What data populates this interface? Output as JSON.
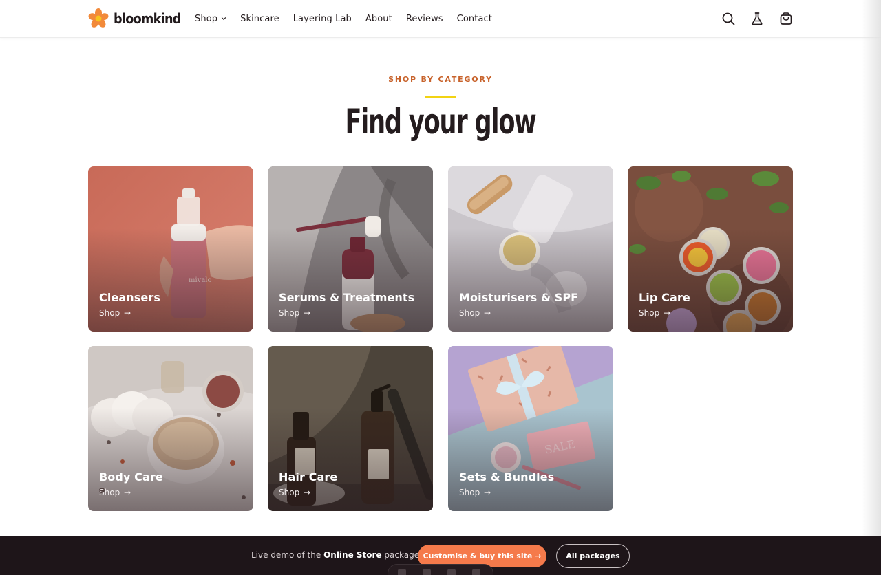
{
  "brand": {
    "name": "bloomkind",
    "logo_icon": "flower-icon",
    "colors": {
      "petal": "#f28a3a",
      "center": "#f7c41f",
      "text": "#211a1c"
    }
  },
  "nav": {
    "items": [
      {
        "label": "Shop",
        "has_caret": true
      },
      {
        "label": "Skincare"
      },
      {
        "label": "Layering Lab"
      },
      {
        "label": "About"
      },
      {
        "label": "Reviews"
      },
      {
        "label": "Contact"
      }
    ],
    "icons": [
      "search-icon",
      "flask-icon",
      "cart-icon"
    ]
  },
  "section": {
    "eyebrow": "SHOP BY CATEGORY",
    "title": "Find your glow",
    "accent": "#c8632c",
    "rule_color": "#f2d313"
  },
  "categories": [
    {
      "title": "Cleansers",
      "link": "Shop",
      "arrow": "→"
    },
    {
      "title": "Serums & Treatments",
      "link": "Shop",
      "arrow": "→"
    },
    {
      "title": "Moisturisers & SPF",
      "link": "Shop",
      "arrow": "→"
    },
    {
      "title": "Lip Care",
      "link": "Shop",
      "arrow": "→"
    },
    {
      "title": "Body Care",
      "link": "Shop",
      "arrow": "→"
    },
    {
      "title": "Hair Care",
      "link": "Shop",
      "arrow": "→"
    },
    {
      "title": "Sets & Bundles",
      "link": "Shop",
      "arrow": "→"
    }
  ],
  "demo_bar": {
    "prefix": "Live demo of the",
    "package": "Online Store",
    "suffix": "package.",
    "customise_button": "Customise & buy this site →",
    "packages_button": "All packages",
    "colors": {
      "background": "#1e1519",
      "cta": "#f57a4b"
    }
  }
}
